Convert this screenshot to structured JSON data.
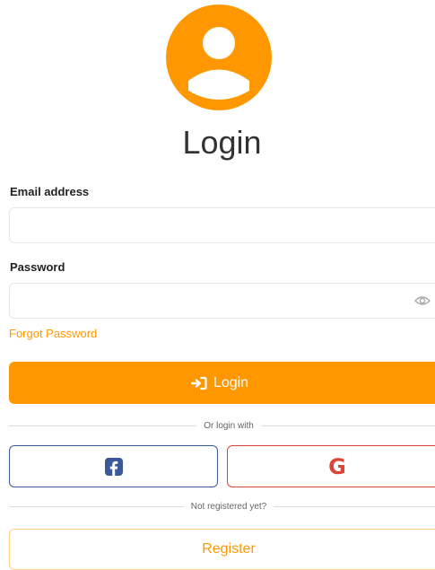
{
  "header": {
    "title": "Login"
  },
  "form": {
    "email_label": "Email address",
    "email_value": "",
    "password_label": "Password",
    "password_value": "",
    "forgot_label": "Forgot Password",
    "login_label": "Login"
  },
  "social": {
    "divider_text": "Or login with",
    "facebook_icon": "facebook-icon",
    "google_letter": "G"
  },
  "register": {
    "divider_text": "Not registered yet?",
    "button_label": "Register"
  },
  "colors": {
    "accent": "#ff9800",
    "facebook": "#3b5998",
    "google": "#db4437"
  }
}
